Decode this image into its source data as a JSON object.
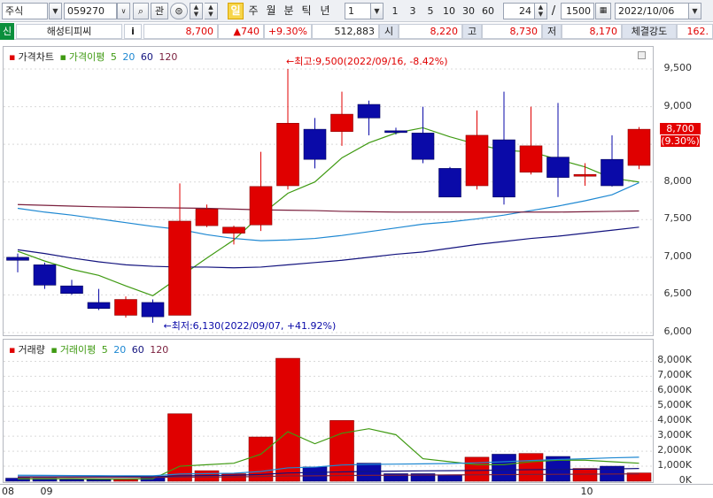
{
  "toolbar": {
    "market_type": "주식",
    "stock_code": "059270",
    "interest_label": "관",
    "periods": [
      "일",
      "주",
      "월",
      "분",
      "틱",
      "년"
    ],
    "active_period": "일",
    "interval_value": "1",
    "intervals": [
      "1",
      "3",
      "5",
      "10",
      "30",
      "60"
    ],
    "count_value": "24",
    "count_separator": "/",
    "total_value": "1500",
    "date_value": "2022/10/06"
  },
  "quote": {
    "credit_badge": "신",
    "stock_name": "해성티피씨",
    "info_label": "i",
    "price": "8,700",
    "change": "▲740",
    "change_rate": "+9.30%",
    "volume": "512,883",
    "open_label": "시",
    "open": "8,220",
    "high_label": "고",
    "high": "8,730",
    "low_label": "저",
    "low": "8,170",
    "strength_label": "체결강도",
    "strength": "162."
  },
  "price_pane": {
    "title": "가격차트",
    "ma_title": "가격이평",
    "ma_periods": [
      "5",
      "20",
      "60",
      "120"
    ],
    "high_annotation": "←최고:9,500(2022/09/16, -8.42%)",
    "low_annotation": "←최저:6,130(2022/09/07, +41.92%)",
    "last_price_label": "8,700",
    "last_rate_label": "(9.30%)"
  },
  "volume_pane": {
    "title": "거래량",
    "ma_title": "거래이평",
    "ma_periods": [
      "5",
      "20",
      "60",
      "120"
    ]
  },
  "colors": {
    "up": "#e00000",
    "down": "#0a0aa8",
    "ma5": "#3f9a12",
    "ma20": "#1e88d2",
    "ma60": "#13137e",
    "ma120": "#7a1f3d"
  },
  "chart_data": {
    "type": "candlestick",
    "price_axis": {
      "ticks": [
        "9,500",
        "9,000",
        "8,500",
        "8,000",
        "7,500",
        "7,000",
        "6,500",
        "6,000"
      ],
      "ylim": [
        6000,
        9700
      ]
    },
    "volume_axis": {
      "ticks": [
        "8,000K",
        "7,000K",
        "6,000K",
        "5,000K",
        "4,000K",
        "3,000K",
        "2,000K",
        "1,000K",
        "0K"
      ],
      "ylim": [
        0,
        8500
      ]
    },
    "x_labels": [
      {
        "text": "08",
        "index": 0
      },
      {
        "text": "09",
        "index": 1
      },
      {
        "text": "10",
        "index": 21
      }
    ],
    "candles": [
      {
        "o": 7000,
        "h": 7050,
        "l": 6800,
        "c": 6960
      },
      {
        "o": 6900,
        "h": 6930,
        "l": 6580,
        "c": 6630
      },
      {
        "o": 6620,
        "h": 6700,
        "l": 6500,
        "c": 6520
      },
      {
        "o": 6400,
        "h": 6580,
        "l": 6300,
        "c": 6320
      },
      {
        "o": 6230,
        "h": 6480,
        "l": 6200,
        "c": 6440
      },
      {
        "o": 6400,
        "h": 6440,
        "l": 6130,
        "c": 6210
      },
      {
        "o": 6230,
        "h": 7980,
        "l": 6230,
        "c": 7480
      },
      {
        "o": 7420,
        "h": 7700,
        "l": 7400,
        "c": 7640
      },
      {
        "o": 7320,
        "h": 7420,
        "l": 7170,
        "c": 7400
      },
      {
        "o": 7430,
        "h": 8400,
        "l": 7350,
        "c": 7940
      },
      {
        "o": 7950,
        "h": 9500,
        "l": 7900,
        "c": 8780
      },
      {
        "o": 8700,
        "h": 8850,
        "l": 8180,
        "c": 8300
      },
      {
        "o": 8670,
        "h": 9200,
        "l": 8480,
        "c": 8900
      },
      {
        "o": 9030,
        "h": 9080,
        "l": 8620,
        "c": 8850
      },
      {
        "o": 8680,
        "h": 8720,
        "l": 8630,
        "c": 8660
      },
      {
        "o": 8650,
        "h": 9000,
        "l": 8250,
        "c": 8300
      },
      {
        "o": 8180,
        "h": 8200,
        "l": 7800,
        "c": 7800
      },
      {
        "o": 7950,
        "h": 8950,
        "l": 7900,
        "c": 8620
      },
      {
        "o": 8560,
        "h": 9200,
        "l": 7700,
        "c": 7800
      },
      {
        "o": 8130,
        "h": 9000,
        "l": 8100,
        "c": 8480
      },
      {
        "o": 8330,
        "h": 9050,
        "l": 7800,
        "c": 8060
      },
      {
        "o": 8100,
        "h": 8250,
        "l": 7950,
        "c": 8100
      },
      {
        "o": 8300,
        "h": 8620,
        "l": 7940,
        "c": 7950
      },
      {
        "o": 8220,
        "h": 8730,
        "l": 8170,
        "c": 8700
      }
    ],
    "volume": [
      200,
      180,
      120,
      100,
      110,
      300,
      4500,
      700,
      500,
      2950,
      8200,
      950,
      4050,
      1200,
      500,
      500,
      400,
      1600,
      1800,
      1850,
      1650,
      850,
      1000,
      550
    ],
    "ma_price": {
      "5": [
        7080,
        6950,
        6840,
        6760,
        6620,
        6490,
        6740,
        6990,
        7230,
        7560,
        7850,
        8000,
        8320,
        8520,
        8650,
        8720,
        8600,
        8500,
        8420,
        8400,
        8300,
        8200,
        8050,
        8000
      ],
      "20": [
        7650,
        7600,
        7560,
        7510,
        7460,
        7410,
        7370,
        7300,
        7250,
        7220,
        7230,
        7250,
        7290,
        7340,
        7390,
        7440,
        7470,
        7510,
        7560,
        7620,
        7680,
        7750,
        7830,
        7990
      ],
      "60": [
        7100,
        7050,
        6990,
        6940,
        6900,
        6880,
        6870,
        6870,
        6860,
        6870,
        6900,
        6930,
        6960,
        7000,
        7040,
        7070,
        7120,
        7170,
        7210,
        7250,
        7280,
        7320,
        7360,
        7400
      ],
      "120": [
        7700,
        7690,
        7680,
        7670,
        7665,
        7660,
        7655,
        7650,
        7640,
        7630,
        7625,
        7620,
        7610,
        7605,
        7600,
        7600,
        7600,
        7600,
        7600,
        7600,
        7600,
        7605,
        7610,
        7615
      ]
    },
    "ma_volume": {
      "5": [
        150,
        150,
        160,
        140,
        140,
        160,
        1000,
        1100,
        1200,
        1800,
        3300,
        2500,
        3200,
        3500,
        3100,
        1500,
        1300,
        1100,
        1100,
        1300,
        1400,
        1400,
        1300,
        1200
      ],
      "20": [
        400,
        390,
        380,
        370,
        360,
        360,
        480,
        510,
        530,
        650,
        890,
        940,
        1080,
        1120,
        1140,
        1160,
        1180,
        1230,
        1300,
        1380,
        1450,
        1500,
        1560,
        1600
      ],
      "60": [
        300,
        300,
        300,
        300,
        300,
        300,
        360,
        380,
        400,
        450,
        550,
        580,
        620,
        650,
        670,
        690,
        700,
        720,
        750,
        770,
        790,
        800,
        820,
        850
      ],
      "120": [
        250,
        250,
        250,
        250,
        250,
        250,
        270,
        280,
        290,
        310,
        350,
        360,
        380,
        390,
        400,
        410,
        420,
        430,
        440,
        450,
        460,
        470,
        480,
        490
      ]
    }
  }
}
